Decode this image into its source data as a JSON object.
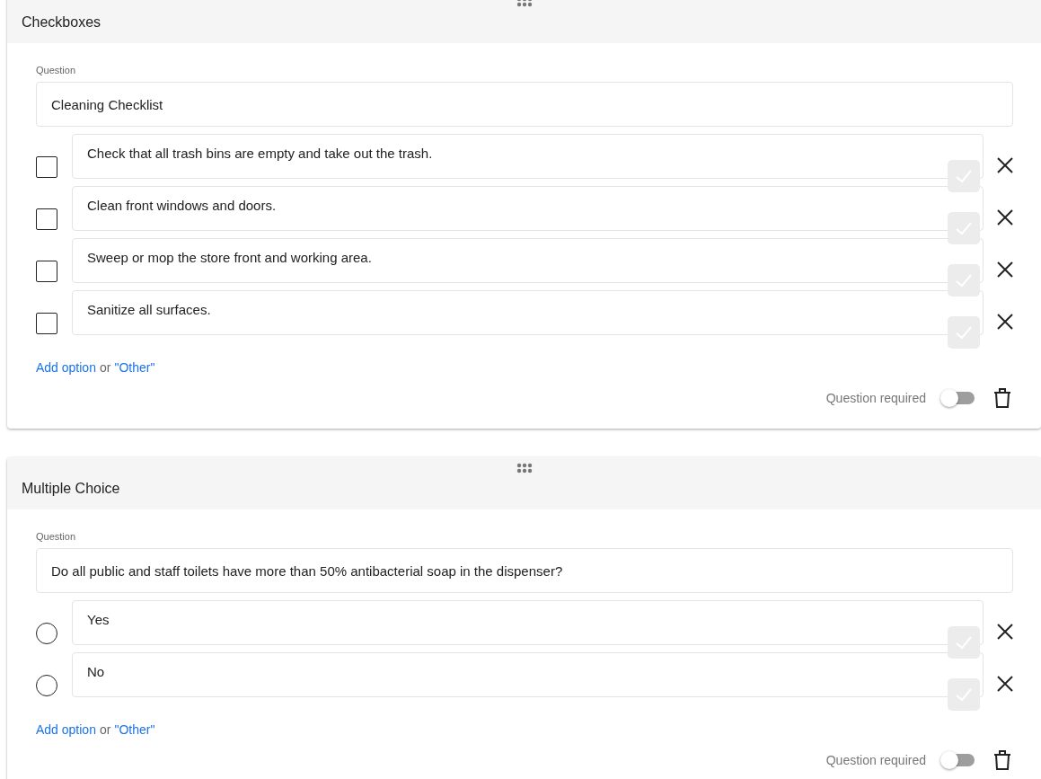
{
  "questions": [
    {
      "kind": "checkbox",
      "type_label": "Checkboxes",
      "question_label": "Question",
      "question": "Cleaning Checklist",
      "options": [
        {
          "text": "Check that all trash bins are empty and take out the trash.",
          "checked": false
        },
        {
          "text": "Clean front windows and doors.",
          "checked": false
        },
        {
          "text": "Sweep or mop the store front and working area.",
          "checked": false
        },
        {
          "text": "Sanitize all surfaces.",
          "checked": false
        }
      ],
      "add_option": "Add option",
      "or": "or",
      "other": "\"Other\"",
      "required_label": "Question required",
      "required": false
    },
    {
      "kind": "radio",
      "type_label": "Multiple Choice",
      "question_label": "Question",
      "question": "Do all public and staff toilets have more than 50% antibacterial soap in the dispenser?",
      "options": [
        {
          "text": "Yes",
          "checked": false
        },
        {
          "text": "No",
          "checked": false
        }
      ],
      "add_option": "Add option",
      "or": "or",
      "other": "\"Other\"",
      "required_label": "Question required",
      "required": false
    }
  ]
}
